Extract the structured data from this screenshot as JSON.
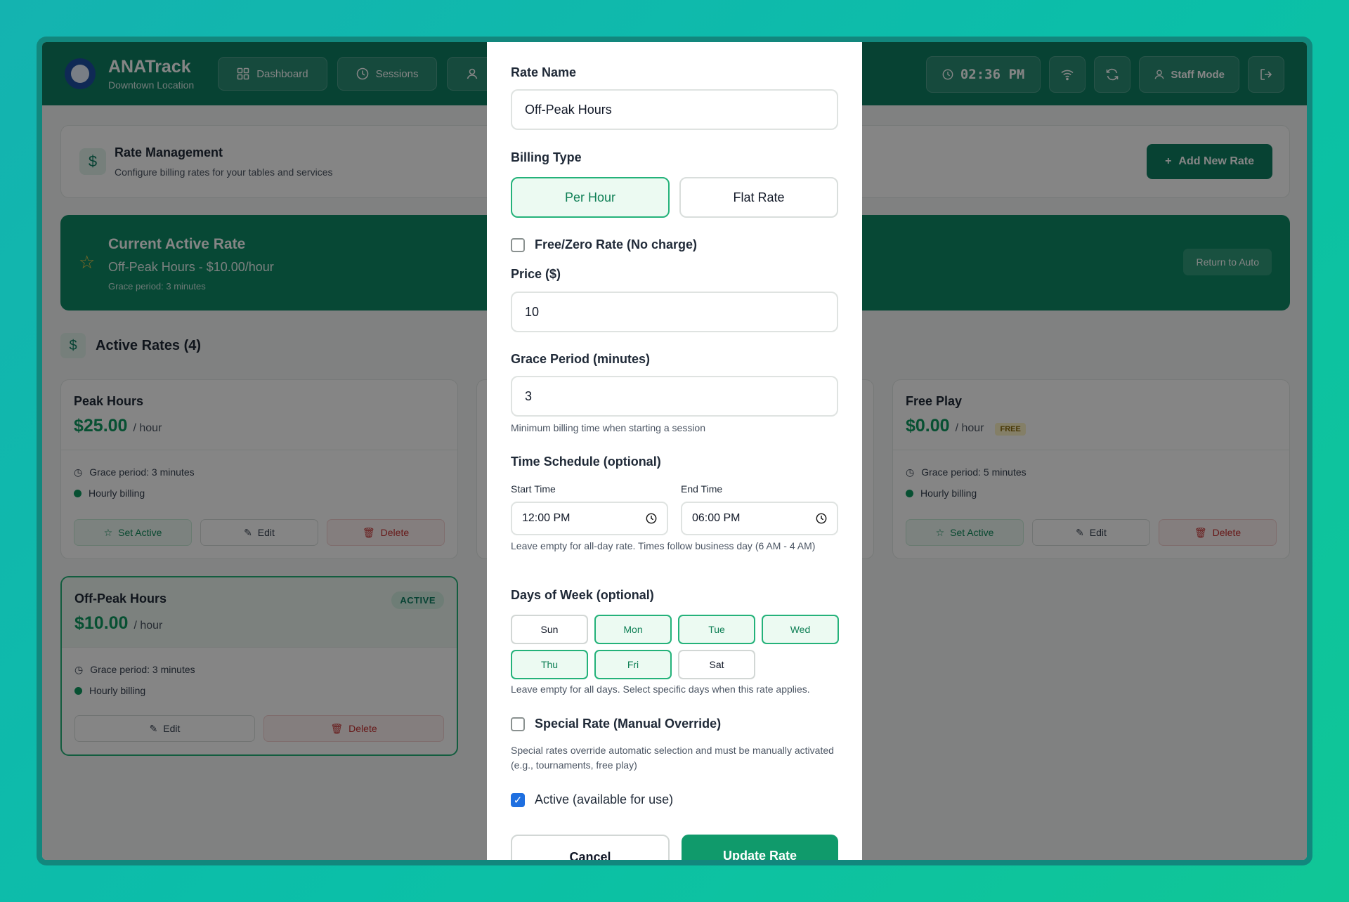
{
  "app": {
    "name": "ANATrack",
    "location": "Downtown Location"
  },
  "nav": [
    {
      "label": "Dashboard",
      "icon": "grid-icon"
    },
    {
      "label": "Sessions",
      "icon": "clock-icon"
    },
    {
      "label": "",
      "icon": "user-icon"
    }
  ],
  "header": {
    "clock": "02:36 PM",
    "staff_mode": "Staff Mode"
  },
  "page": {
    "title": "Rate Management",
    "subtitle": "Configure billing rates for your tables and services",
    "add_button": "Add New Rate"
  },
  "current_rate": {
    "title": "Current Active Rate",
    "value": "Off-Peak Hours - $10.00/hour",
    "grace": "Grace period: 3 minutes",
    "return_button": "Return to Auto"
  },
  "rates_section": {
    "title": "Active Rates (4)"
  },
  "rates": {
    "peak": {
      "name": "Peak Hours",
      "price": "$25.00",
      "unit": "/ hour",
      "grace": "Grace period: 3 minutes",
      "billing": "Hourly billing",
      "set_active": "Set Active",
      "edit": "Edit",
      "delete": "Delete"
    },
    "free": {
      "name": "Free Play",
      "price": "$0.00",
      "unit": "/ hour",
      "badge": "FREE",
      "grace": "Grace period: 5 minutes",
      "billing": "Hourly billing",
      "set_active": "Set Active",
      "edit": "Edit",
      "delete": "Delete"
    },
    "offpeak": {
      "name": "Off-Peak Hours",
      "price": "$10.00",
      "unit": "/ hour",
      "badge": "ACTIVE",
      "grace": "Grace period: 3 minutes",
      "billing": "Hourly billing",
      "edit": "Edit",
      "delete": "Delete"
    }
  },
  "modal": {
    "rate_name_label": "Rate Name",
    "rate_name_value": "Off-Peak Hours",
    "billing_type_label": "Billing Type",
    "billing_per_hour": "Per Hour",
    "billing_flat": "Flat Rate",
    "free_rate_label": "Free/Zero Rate (No charge)",
    "price_label": "Price ($)",
    "price_value": "10",
    "grace_label": "Grace Period (minutes)",
    "grace_value": "3",
    "grace_hint": "Minimum billing time when starting a session",
    "schedule_label": "Time Schedule (optional)",
    "start_label": "Start Time",
    "start_value": "12:00 PM",
    "end_label": "End Time",
    "end_value": "06:00 PM",
    "schedule_hint": "Leave empty for all-day rate. Times follow business day (6 AM - 4 AM)",
    "days_label": "Days of Week (optional)",
    "days": {
      "sun": "Sun",
      "mon": "Mon",
      "tue": "Tue",
      "wed": "Wed",
      "thu": "Thu",
      "fri": "Fri",
      "sat": "Sat"
    },
    "days_hint": "Leave empty for all days. Select specific days when this rate applies.",
    "special_label": "Special Rate (Manual Override)",
    "special_hint": "Special rates override automatic selection and must be manually activated (e.g., tournaments, free play)",
    "active_label": "Active (available for use)",
    "cancel": "Cancel",
    "update": "Update Rate"
  },
  "colors": {
    "brand": "#0e7f63",
    "accent": "#24b27a",
    "price": "#0e9960"
  }
}
